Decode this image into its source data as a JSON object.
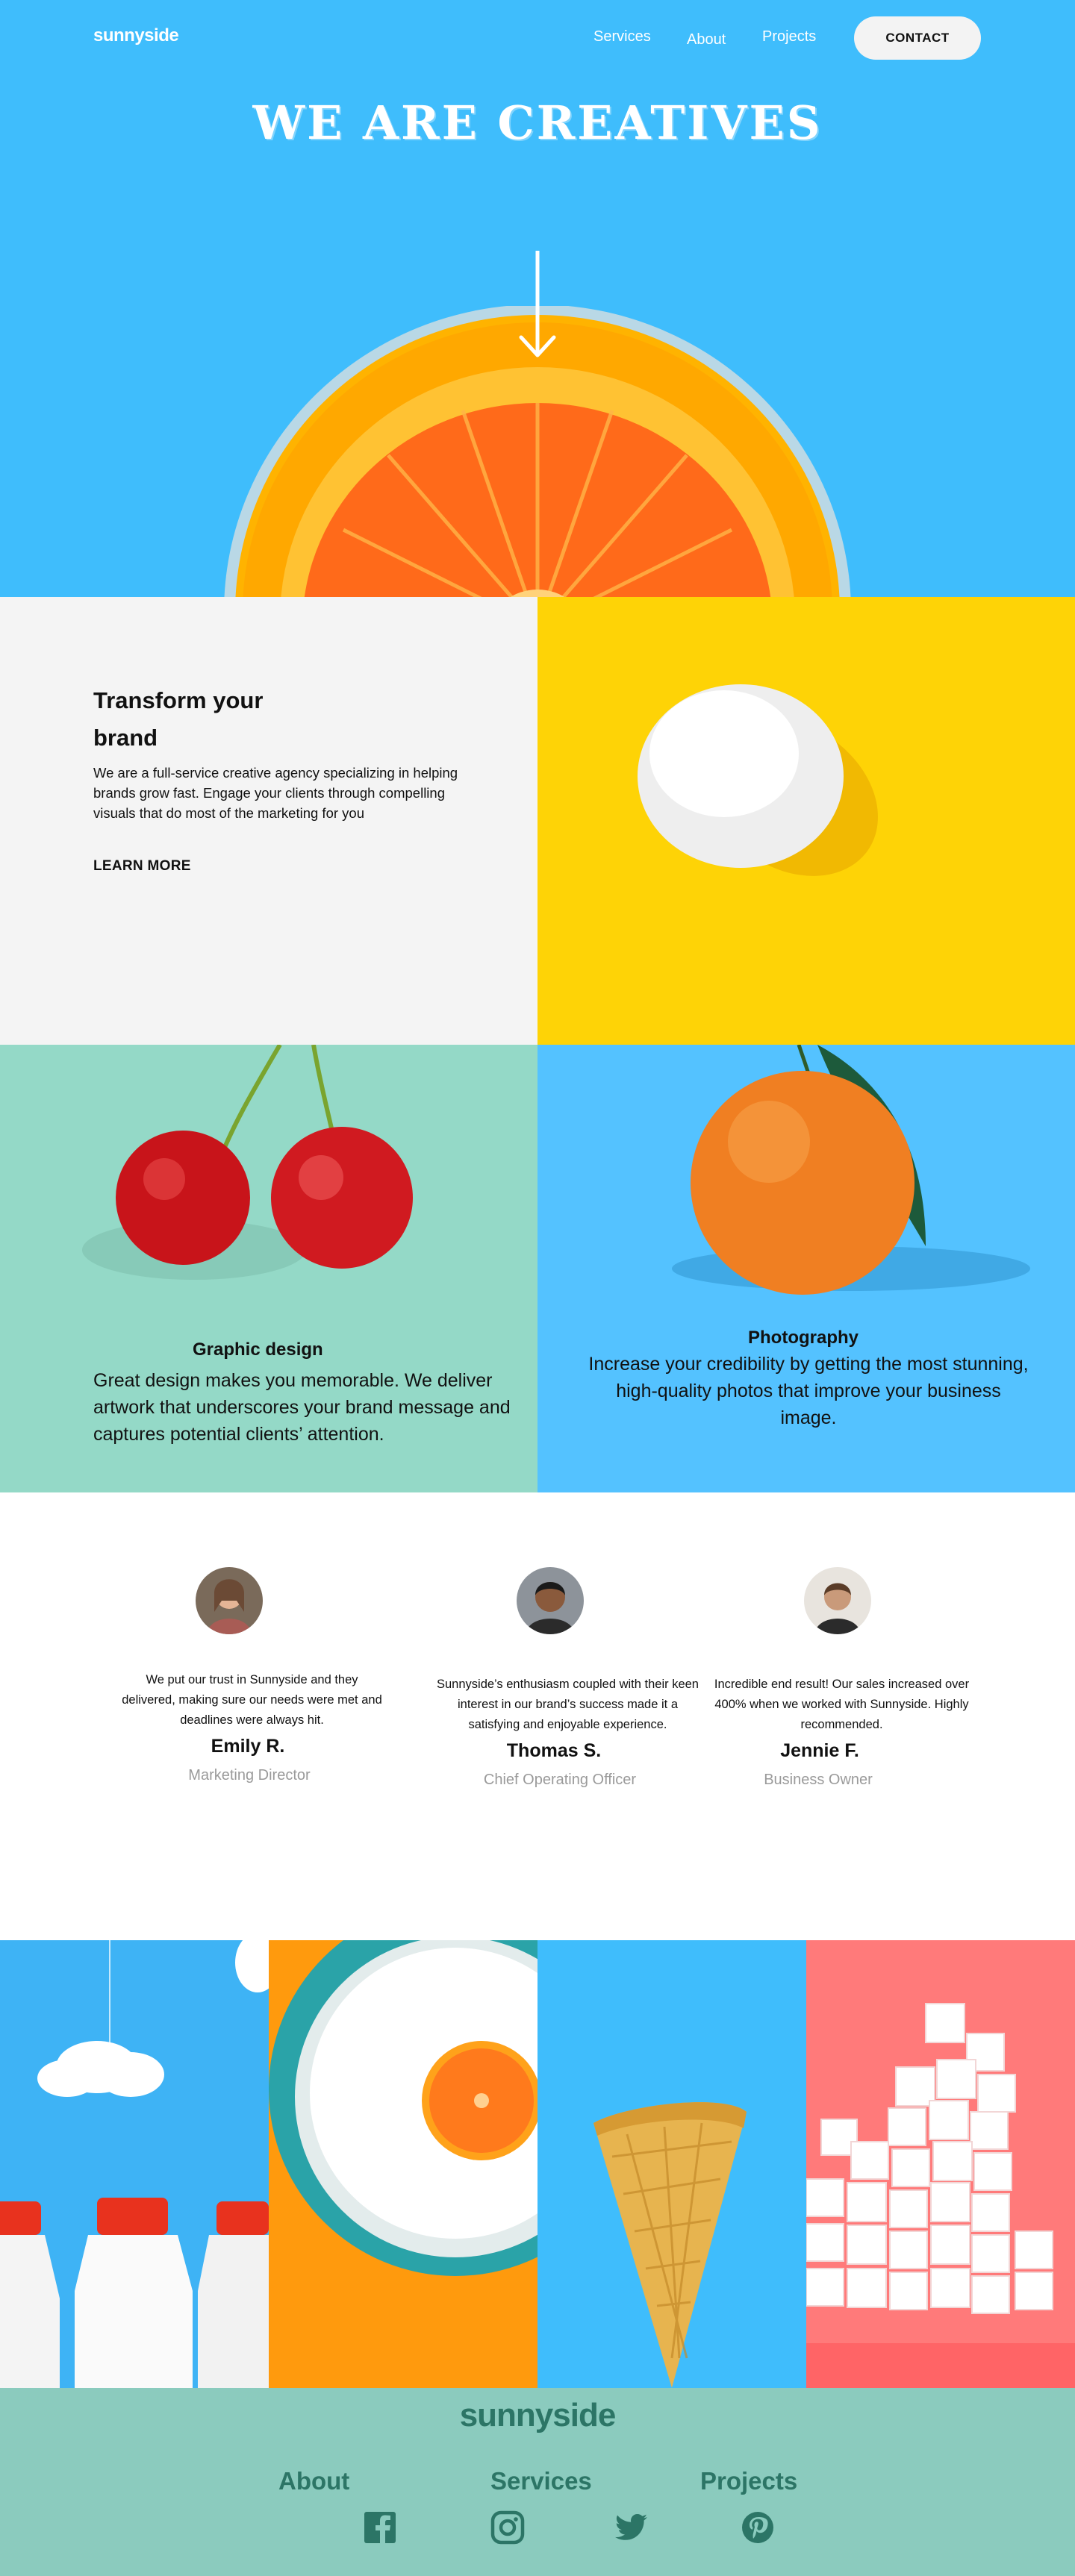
{
  "header": {
    "logo": "sunnyside",
    "nav": {
      "services": "Services",
      "about": "About",
      "projects": "Projects"
    },
    "contact_label": "CONTACT"
  },
  "hero": {
    "title": "WE ARE CREATIVES",
    "arrow_icon": "arrow-down-icon"
  },
  "transform": {
    "title": "Transform your brand",
    "text": "We are a full-service creative agency specializing in helping brands grow fast. Engage your clients through compelling visuals that do most of the marketing for you",
    "link": "LEARN MORE"
  },
  "services": {
    "graphic_design": {
      "title": "Graphic design",
      "text": "Great design makes you memorable. We deliver artwork that underscores your brand message and captures potential clients’ attention."
    },
    "photography": {
      "title": "Photography",
      "text": "Increase your credibility by getting the most stunning, high-quality photos that improve your business image."
    }
  },
  "testimonials": [
    {
      "quote": "We put our trust in Sunnyside and they delivered, making sure our needs were met and deadlines were always hit.",
      "name": "Emily R.",
      "role": "Marketing Director"
    },
    {
      "quote": "Sunnyside’s enthusiasm coupled with their keen interest in our brand’s success made it a satisfying and enjoyable experience.",
      "name": "Thomas S.",
      "role": "Chief Operating Officer"
    },
    {
      "quote": "Incredible end result! Our sales increased over 400% when we worked with Sunnyside. Highly recommended.",
      "name": "Jennie F.",
      "role": "Business Owner"
    }
  ],
  "footer": {
    "logo": "sunnyside",
    "links": {
      "about": "About",
      "services": "Services",
      "projects": "Projects"
    },
    "social_icons": [
      "facebook-icon",
      "instagram-icon",
      "twitter-icon",
      "pinterest-icon"
    ]
  },
  "colors": {
    "hero_blue": "#3fbdfc",
    "yellow": "#fed306",
    "mint": "#94d9c7",
    "light_blue": "#54c2ff",
    "footer_green": "#8bcbbe",
    "footer_text": "#2c7566"
  }
}
